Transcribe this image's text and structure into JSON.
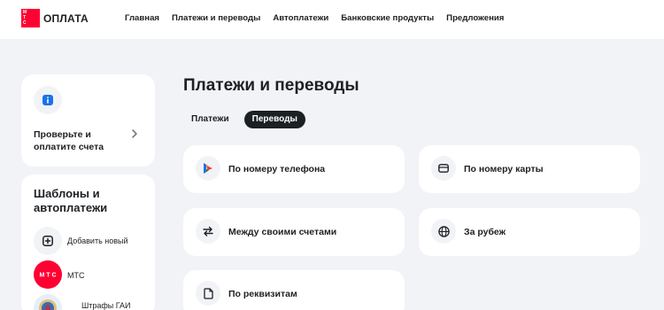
{
  "header": {
    "logo_mark": "МТС",
    "logo_text": "ОПЛАТА",
    "nav": [
      "Главная",
      "Платежи и переводы",
      "Автоплатежи",
      "Банковские продукты",
      "Предложения"
    ]
  },
  "sidebar": {
    "check_card": {
      "text": "Проверьте и оплатите счета"
    },
    "templates": {
      "title": "Шаблоны и автоплатежи",
      "items": [
        {
          "label": "Добавить новый",
          "icon": "plus-square-icon"
        },
        {
          "label": "МТС",
          "icon": "mts-logo-icon"
        },
        {
          "label": "Штрафы ГАИ",
          "icon": "gai-emblem-icon"
        }
      ]
    }
  },
  "main": {
    "title": "Платежи и переводы",
    "tabs": [
      {
        "label": "Платежи",
        "active": false
      },
      {
        "label": "Переводы",
        "active": true
      }
    ],
    "operations": [
      {
        "label": "По номеру телефона",
        "icon": "sbp-icon"
      },
      {
        "label": "По номеру карты",
        "icon": "card-icon"
      },
      {
        "label": "Между своими счетами",
        "icon": "exchange-arrows-icon"
      },
      {
        "label": "За рубеж",
        "icon": "globe-icon"
      },
      {
        "label": "По реквизитам",
        "icon": "document-icon"
      }
    ]
  },
  "colors": {
    "brand": "#ff0032",
    "background": "#f2f3f7",
    "text": "#1d2023",
    "accent_blue": "#1a73e8"
  }
}
